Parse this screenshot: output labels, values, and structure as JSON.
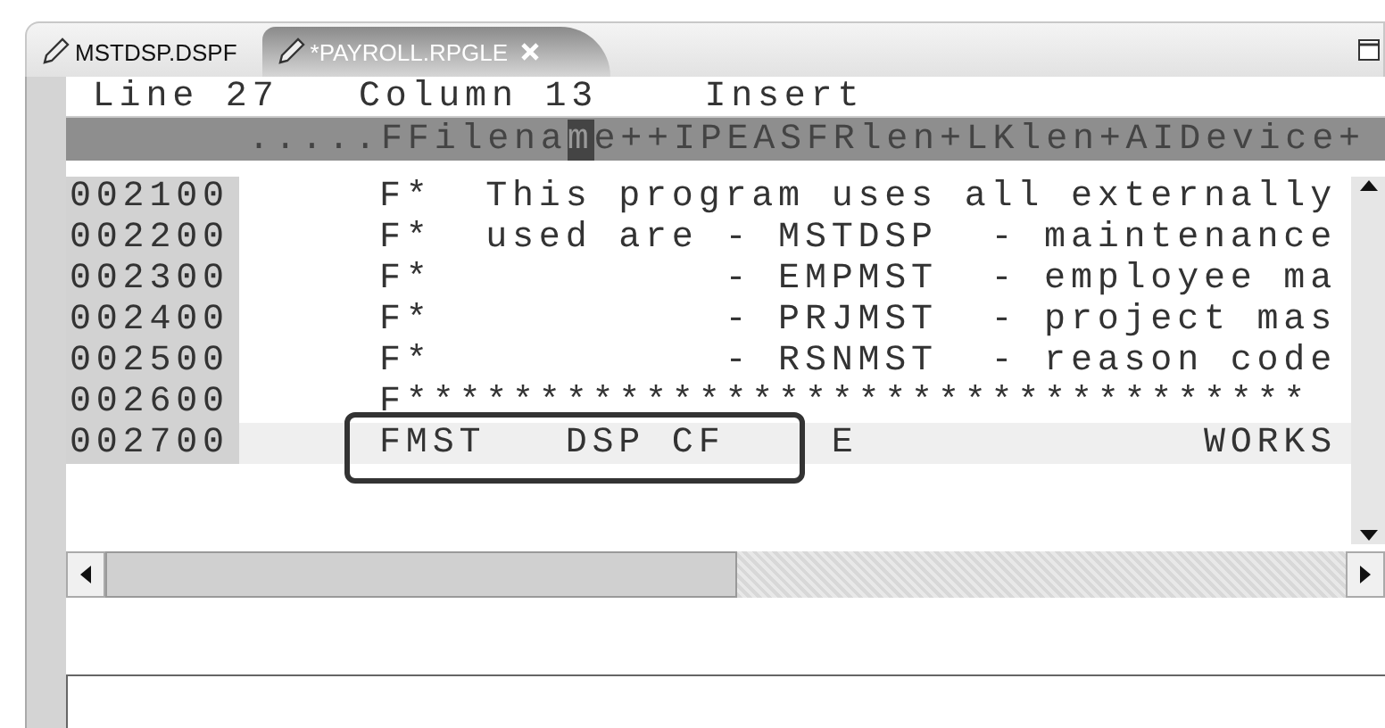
{
  "tabs": [
    {
      "label": "MSTDSP.DSPF",
      "selected": false,
      "closable": false
    },
    {
      "label": "*PAYROLL.RPGLE",
      "selected": true,
      "closable": true
    }
  ],
  "status": {
    "line": "Line 27",
    "column": "Column 13",
    "mode": "Insert"
  },
  "ruler": {
    "before": ".....FFilena",
    "cursor": "m",
    "after": "e++IPEASFRlen+LKlen+AIDevice+"
  },
  "lines": [
    {
      "seq": "002100",
      "text": "     F*  This program uses all externally",
      "selected": false,
      "boxed": false
    },
    {
      "seq": "002200",
      "text": "     F*  used are - MSTDSP  - maintenance",
      "selected": false,
      "boxed": false
    },
    {
      "seq": "002300",
      "text": "     F*           - EMPMST  - employee ma",
      "selected": false,
      "boxed": false
    },
    {
      "seq": "002400",
      "text": "     F*           - PRJMST  - project mas",
      "selected": false,
      "boxed": false
    },
    {
      "seq": "002500",
      "text": "     F*           - RSNMST  - reason code",
      "selected": false,
      "boxed": false
    },
    {
      "seq": "002600",
      "text": "     F**********************************",
      "selected": false,
      "boxed": false
    },
    {
      "seq": "002700",
      "text": "     FMST   DSP CF    E             WORKS",
      "selected": true,
      "boxed": true
    }
  ]
}
